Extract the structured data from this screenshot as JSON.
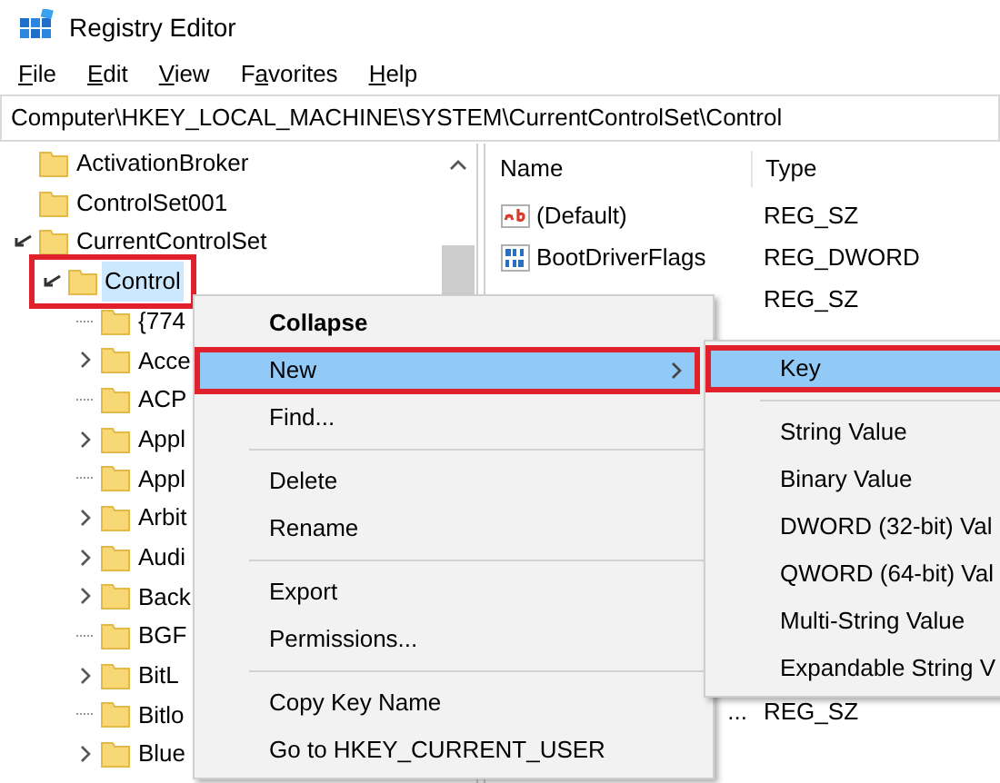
{
  "window": {
    "title": "Registry Editor"
  },
  "menu_bar": [
    {
      "key": "F",
      "post": "ile"
    },
    {
      "key": "E",
      "post": "dit"
    },
    {
      "key": "V",
      "post": "iew"
    },
    {
      "pre": "F",
      "key": "a",
      "post": "vorites"
    },
    {
      "key": "H",
      "post": "elp"
    }
  ],
  "address": "Computer\\HKEY_LOCAL_MACHINE\\SYSTEM\\CurrentControlSet\\Control",
  "tree": [
    {
      "label": "ActivationBroker",
      "selected": false,
      "highlighted": false
    },
    {
      "label": "ControlSet001",
      "selected": false,
      "highlighted": false
    },
    {
      "label": "CurrentControlSet",
      "expandable": true,
      "expanded": true,
      "selected": false,
      "highlighted": false,
      "children": [
        {
          "label": "Control",
          "expandable": true,
          "expanded": true,
          "selected": true,
          "highlighted": true,
          "children": [
            {
              "label": "{774",
              "expandable": false,
              "selected": false,
              "highlighted": false
            },
            {
              "label": "Acce",
              "expandable": true,
              "expanded": false,
              "selected": false,
              "highlighted": false
            },
            {
              "label": "ACP",
              "expandable": false,
              "selected": false,
              "highlighted": false
            },
            {
              "label": "Appl",
              "expandable": true,
              "expanded": false,
              "selected": false,
              "highlighted": false
            },
            {
              "label": "Appl",
              "expandable": false,
              "selected": false,
              "highlighted": false
            },
            {
              "label": "Arbit",
              "expandable": true,
              "expanded": false,
              "selected": false,
              "highlighted": false
            },
            {
              "label": "Audi",
              "expandable": true,
              "expanded": false,
              "selected": false,
              "highlighted": false
            },
            {
              "label": "Back",
              "expandable": true,
              "expanded": false,
              "selected": false,
              "highlighted": false
            },
            {
              "label": "BGF",
              "expandable": false,
              "selected": false,
              "highlighted": false
            },
            {
              "label": "BitL",
              "expandable": true,
              "expanded": false,
              "selected": false,
              "highlighted": false
            },
            {
              "label": "Bitlo",
              "expandable": false,
              "selected": false,
              "highlighted": false
            },
            {
              "label": "Blue",
              "expandable": true,
              "expanded": false,
              "selected": false,
              "highlighted": false
            }
          ]
        }
      ]
    }
  ],
  "values_list": {
    "columns": [
      "Name",
      "Type"
    ],
    "rows": [
      {
        "kind": "string_value",
        "name": "(Default)",
        "type": "REG_SZ"
      },
      {
        "kind": "binary_value",
        "name": "BootDriverFlags",
        "type": "REG_DWORD"
      },
      {
        "kind": "hidden_name",
        "type": "REG_SZ"
      },
      {
        "kind": "after_gap",
        "name": "...",
        "type": "REG_SZ"
      }
    ]
  },
  "context_menu": {
    "groups": [
      [
        {
          "label": "Collapse",
          "bold": true,
          "selected": false,
          "highlighted": false,
          "submenu": false
        },
        {
          "label": "New",
          "bold": false,
          "selected": true,
          "highlighted": true,
          "submenu": true
        },
        {
          "label": "Find...",
          "bold": false,
          "selected": false,
          "highlighted": false,
          "submenu": false
        }
      ],
      [
        {
          "label": "Delete",
          "bold": false,
          "selected": false,
          "highlighted": false,
          "submenu": false
        },
        {
          "label": "Rename",
          "bold": false,
          "selected": false,
          "highlighted": false,
          "submenu": false
        }
      ],
      [
        {
          "label": "Export",
          "bold": false,
          "selected": false,
          "highlighted": false,
          "submenu": false
        },
        {
          "label": "Permissions...",
          "bold": false,
          "selected": false,
          "highlighted": false,
          "submenu": false
        }
      ],
      [
        {
          "label": "Copy Key Name",
          "bold": false,
          "selected": false,
          "highlighted": false,
          "submenu": false
        },
        {
          "label": "Go to HKEY_CURRENT_USER",
          "bold": false,
          "selected": false,
          "highlighted": false,
          "submenu": false
        }
      ]
    ]
  },
  "submenu": {
    "groups": [
      [
        {
          "label": "Key",
          "selected": true,
          "highlighted": true
        }
      ],
      [
        {
          "label": "String Value",
          "selected": false,
          "highlighted": false
        },
        {
          "label": "Binary Value",
          "selected": false,
          "highlighted": false
        },
        {
          "label": "DWORD (32-bit) Val",
          "selected": false,
          "highlighted": false
        },
        {
          "label": "QWORD (64-bit) Val",
          "selected": false,
          "highlighted": false
        },
        {
          "label": "Multi-String Value",
          "selected": false,
          "highlighted": false
        },
        {
          "label": "Expandable String V",
          "selected": false,
          "highlighted": false
        }
      ]
    ]
  }
}
